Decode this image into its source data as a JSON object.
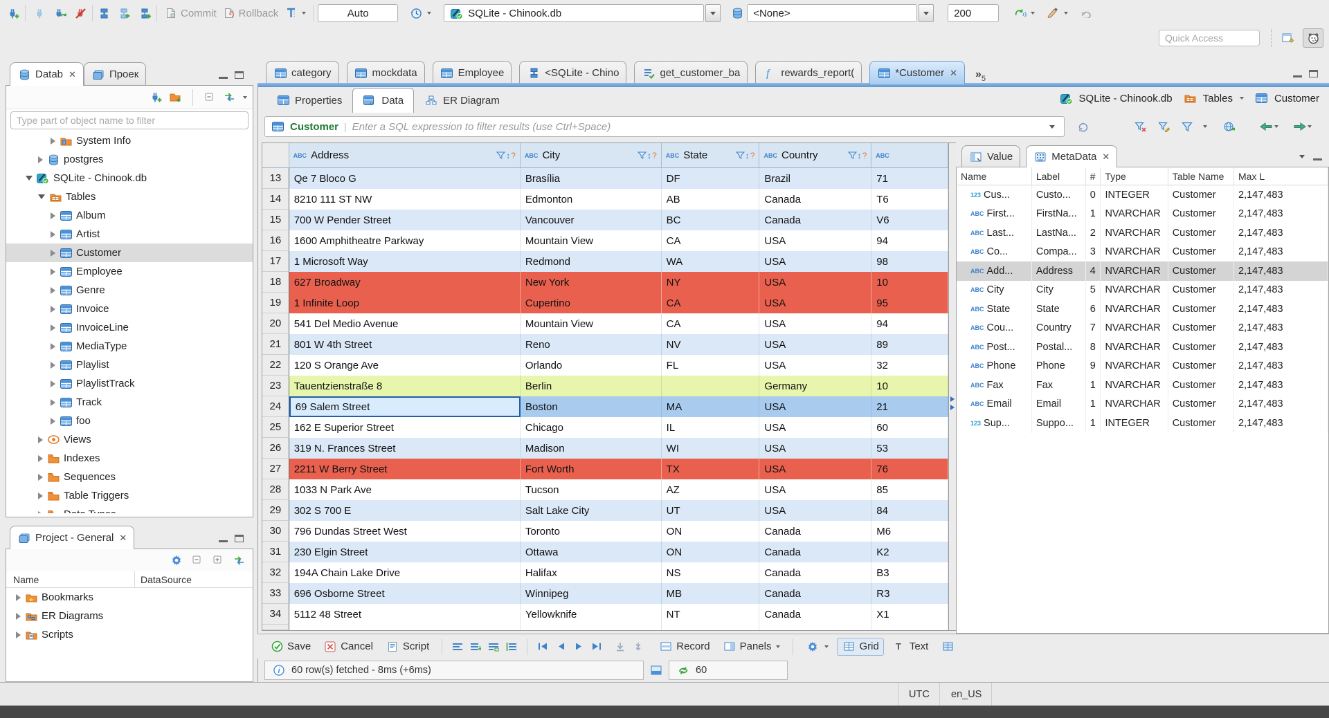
{
  "toolbar": {
    "commit": "Commit",
    "rollback": "Rollback",
    "auto": "Auto",
    "connection": "SQLite - Chinook.db",
    "schema": "<None>",
    "fetch_size": "200",
    "quick_access_placeholder": "Quick Access"
  },
  "navigator": {
    "tab_db": "Datab",
    "tab_project": "Проек",
    "filter_placeholder": "Type part of object name to filter",
    "tree": [
      {
        "label": "System Info",
        "icon": "folder_info",
        "depth": 3,
        "arrow": "right",
        "selected": false
      },
      {
        "label": "postgres",
        "icon": "db",
        "depth": 2,
        "arrow": "right",
        "selected": false
      },
      {
        "label": "SQLite - Chinook.db",
        "icon": "sqlite",
        "depth": 1,
        "arrow": "down",
        "selected": false
      },
      {
        "label": "Tables",
        "icon": "folder_table",
        "depth": 2,
        "arrow": "down",
        "selected": false
      },
      {
        "label": "Album",
        "icon": "table",
        "depth": 3,
        "arrow": "right",
        "selected": false
      },
      {
        "label": "Artist",
        "icon": "table",
        "depth": 3,
        "arrow": "right",
        "selected": false
      },
      {
        "label": "Customer",
        "icon": "table",
        "depth": 3,
        "arrow": "right",
        "selected": true
      },
      {
        "label": "Employee",
        "icon": "table",
        "depth": 3,
        "arrow": "right",
        "selected": false
      },
      {
        "label": "Genre",
        "icon": "table",
        "depth": 3,
        "arrow": "right",
        "selected": false
      },
      {
        "label": "Invoice",
        "icon": "table",
        "depth": 3,
        "arrow": "right",
        "selected": false
      },
      {
        "label": "InvoiceLine",
        "icon": "table",
        "depth": 3,
        "arrow": "right",
        "selected": false
      },
      {
        "label": "MediaType",
        "icon": "table",
        "depth": 3,
        "arrow": "right",
        "selected": false
      },
      {
        "label": "Playlist",
        "icon": "table",
        "depth": 3,
        "arrow": "right",
        "selected": false
      },
      {
        "label": "PlaylistTrack",
        "icon": "table",
        "depth": 3,
        "arrow": "right",
        "selected": false
      },
      {
        "label": "Track",
        "icon": "table",
        "depth": 3,
        "arrow": "right",
        "selected": false
      },
      {
        "label": "foo",
        "icon": "table",
        "depth": 3,
        "arrow": "right",
        "selected": false
      },
      {
        "label": "Views",
        "icon": "eye",
        "depth": 2,
        "arrow": "right",
        "selected": false
      },
      {
        "label": "Indexes",
        "icon": "folder",
        "depth": 2,
        "arrow": "right",
        "selected": false
      },
      {
        "label": "Sequences",
        "icon": "folder",
        "depth": 2,
        "arrow": "right",
        "selected": false
      },
      {
        "label": "Table Triggers",
        "icon": "folder",
        "depth": 2,
        "arrow": "right",
        "selected": false
      },
      {
        "label": "Data Types",
        "icon": "folder",
        "depth": 2,
        "arrow": "right",
        "selected": false
      }
    ]
  },
  "project": {
    "tab": "Project - General",
    "col_name": "Name",
    "col_datasource": "DataSource",
    "items": [
      {
        "label": "Bookmarks",
        "icon": "folder_star"
      },
      {
        "label": "ER Diagrams",
        "icon": "folder_diagram"
      },
      {
        "label": "Scripts",
        "icon": "folder_script"
      }
    ]
  },
  "editor": {
    "tabs": [
      {
        "label": "category",
        "icon": "table",
        "active": false,
        "closable": false
      },
      {
        "label": "mockdata",
        "icon": "table",
        "active": false,
        "closable": false
      },
      {
        "label": "Employee",
        "icon": "table",
        "active": false,
        "closable": false
      },
      {
        "label": "<SQLite - Chino",
        "icon": "sql",
        "active": false,
        "closable": false
      },
      {
        "label": "get_customer_ba",
        "icon": "sql_check",
        "active": false,
        "closable": false
      },
      {
        "label": "rewards_report(",
        "icon": "fx",
        "active": false,
        "closable": false
      },
      {
        "label": "*Customer",
        "icon": "table",
        "active": true,
        "closable": true
      }
    ],
    "overflow_chevron": "»",
    "overflow_count": "5",
    "subtabs": [
      {
        "label": "Properties",
        "icon": "table_props",
        "active": false
      },
      {
        "label": "Data",
        "icon": "table_data",
        "active": true
      },
      {
        "label": "ER Diagram",
        "icon": "er",
        "active": false
      }
    ],
    "breadcrumb": {
      "connection": "SQLite - Chinook.db",
      "folder": "Tables",
      "table": "Customer"
    }
  },
  "filter": {
    "table": "Customer",
    "placeholder": "Enter a SQL expression to filter results (use Ctrl+Space)"
  },
  "grid": {
    "columns": [
      {
        "label": "Address"
      },
      {
        "label": "City"
      },
      {
        "label": "State"
      },
      {
        "label": "Country"
      },
      {
        "label": ""
      }
    ],
    "rows": [
      {
        "n": "13",
        "address": "Qe 7 Bloco G",
        "city": "Brasília",
        "state": "DF",
        "country": "Brazil",
        "postal": "71",
        "style": "blue"
      },
      {
        "n": "14",
        "address": "8210 111 ST NW",
        "city": "Edmonton",
        "state": "AB",
        "country": "Canada",
        "postal": "T6",
        "style": "white"
      },
      {
        "n": "15",
        "address": "700 W Pender Street",
        "city": "Vancouver",
        "state": "BC",
        "country": "Canada",
        "postal": "V6",
        "style": "blue"
      },
      {
        "n": "16",
        "address": "1600 Amphitheatre Parkway",
        "city": "Mountain View",
        "state": "CA",
        "country": "USA",
        "postal": "94",
        "style": "white"
      },
      {
        "n": "17",
        "address": "1 Microsoft Way",
        "city": "Redmond",
        "state": "WA",
        "country": "USA",
        "postal": "98",
        "style": "blue"
      },
      {
        "n": "18",
        "address": "627 Broadway",
        "city": "New York",
        "state": "NY",
        "country": "USA",
        "postal": "10",
        "style": "red"
      },
      {
        "n": "19",
        "address": "1 Infinite Loop",
        "city": "Cupertino",
        "state": "CA",
        "country": "USA",
        "postal": "95",
        "style": "red"
      },
      {
        "n": "20",
        "address": "541 Del Medio Avenue",
        "city": "Mountain View",
        "state": "CA",
        "country": "USA",
        "postal": "94",
        "style": "white"
      },
      {
        "n": "21",
        "address": "801 W 4th Street",
        "city": "Reno",
        "state": "NV",
        "country": "USA",
        "postal": "89",
        "style": "blue"
      },
      {
        "n": "22",
        "address": "120 S Orange Ave",
        "city": "Orlando",
        "state": "FL",
        "country": "USA",
        "postal": "32",
        "style": "white"
      },
      {
        "n": "23",
        "address": "Tauentzienstraße 8",
        "city": "Berlin",
        "state": "",
        "country": "Germany",
        "postal": "10",
        "style": "green"
      },
      {
        "n": "24",
        "address": "69 Salem Street",
        "city": "Boston",
        "state": "MA",
        "country": "USA",
        "postal": "21",
        "style": "sel"
      },
      {
        "n": "25",
        "address": "162 E Superior Street",
        "city": "Chicago",
        "state": "IL",
        "country": "USA",
        "postal": "60",
        "style": "white"
      },
      {
        "n": "26",
        "address": "319 N. Frances Street",
        "city": "Madison",
        "state": "WI",
        "country": "USA",
        "postal": "53",
        "style": "blue"
      },
      {
        "n": "27",
        "address": "2211 W Berry Street",
        "city": "Fort Worth",
        "state": "TX",
        "country": "USA",
        "postal": "76",
        "style": "red"
      },
      {
        "n": "28",
        "address": "1033 N Park Ave",
        "city": "Tucson",
        "state": "AZ",
        "country": "USA",
        "postal": "85",
        "style": "white"
      },
      {
        "n": "29",
        "address": "302 S 700 E",
        "city": "Salt Lake City",
        "state": "UT",
        "country": "USA",
        "postal": "84",
        "style": "blue"
      },
      {
        "n": "30",
        "address": "796 Dundas Street West",
        "city": "Toronto",
        "state": "ON",
        "country": "Canada",
        "postal": "M6",
        "style": "white"
      },
      {
        "n": "31",
        "address": "230 Elgin Street",
        "city": "Ottawa",
        "state": "ON",
        "country": "Canada",
        "postal": "K2",
        "style": "blue"
      },
      {
        "n": "32",
        "address": "194A Chain Lake Drive",
        "city": "Halifax",
        "state": "NS",
        "country": "Canada",
        "postal": "B3",
        "style": "white"
      },
      {
        "n": "33",
        "address": "696 Osborne Street",
        "city": "Winnipeg",
        "state": "MB",
        "country": "Canada",
        "postal": "R3",
        "style": "blue"
      },
      {
        "n": "34",
        "address": "5112 48 Street",
        "city": "Yellowknife",
        "state": "NT",
        "country": "Canada",
        "postal": "X1",
        "style": "white"
      }
    ]
  },
  "meta": {
    "tab_value": "Value",
    "tab_metadata": "MetaData",
    "cols": [
      "Name",
      "Label",
      "#",
      "Type",
      "Table Name",
      "Max L"
    ],
    "rows": [
      {
        "icon": "123",
        "name": "Cus...",
        "label": "Custo...",
        "num": "0",
        "type": "INTEGER",
        "table": "Customer",
        "max": "2,147,483",
        "selected": false
      },
      {
        "icon": "abc",
        "name": "First...",
        "label": "FirstNa...",
        "num": "1",
        "type": "NVARCHAR",
        "table": "Customer",
        "max": "2,147,483",
        "selected": false
      },
      {
        "icon": "abc",
        "name": "Last...",
        "label": "LastNa...",
        "num": "2",
        "type": "NVARCHAR",
        "table": "Customer",
        "max": "2,147,483",
        "selected": false
      },
      {
        "icon": "abc",
        "name": "Co...",
        "label": "Compa...",
        "num": "3",
        "type": "NVARCHAR",
        "table": "Customer",
        "max": "2,147,483",
        "selected": false
      },
      {
        "icon": "abc",
        "name": "Add...",
        "label": "Address",
        "num": "4",
        "type": "NVARCHAR",
        "table": "Customer",
        "max": "2,147,483",
        "selected": true
      },
      {
        "icon": "abc",
        "name": "City",
        "label": "City",
        "num": "5",
        "type": "NVARCHAR",
        "table": "Customer",
        "max": "2,147,483",
        "selected": false
      },
      {
        "icon": "abc",
        "name": "State",
        "label": "State",
        "num": "6",
        "type": "NVARCHAR",
        "table": "Customer",
        "max": "2,147,483",
        "selected": false
      },
      {
        "icon": "abc",
        "name": "Cou...",
        "label": "Country",
        "num": "7",
        "type": "NVARCHAR",
        "table": "Customer",
        "max": "2,147,483",
        "selected": false
      },
      {
        "icon": "abc",
        "name": "Post...",
        "label": "Postal...",
        "num": "8",
        "type": "NVARCHAR",
        "table": "Customer",
        "max": "2,147,483",
        "selected": false
      },
      {
        "icon": "abc",
        "name": "Phone",
        "label": "Phone",
        "num": "9",
        "type": "NVARCHAR",
        "table": "Customer",
        "max": "2,147,483",
        "selected": false
      },
      {
        "icon": "abc",
        "name": "Fax",
        "label": "Fax",
        "num": "1",
        "type": "NVARCHAR",
        "table": "Customer",
        "max": "2,147,483",
        "selected": false
      },
      {
        "icon": "abc",
        "name": "Email",
        "label": "Email",
        "num": "1",
        "type": "NVARCHAR",
        "table": "Customer",
        "max": "2,147,483",
        "selected": false
      },
      {
        "icon": "123",
        "name": "Sup...",
        "label": "Suppo...",
        "num": "1",
        "type": "INTEGER",
        "table": "Customer",
        "max": "2,147,483",
        "selected": false
      }
    ]
  },
  "result_toolbar": {
    "save": "Save",
    "cancel": "Cancel",
    "script": "Script",
    "record": "Record",
    "panels": "Panels",
    "grid": "Grid",
    "text": "Text"
  },
  "status": {
    "fetch_info": "60 row(s) fetched - 8ms (+6ms)",
    "refresh_count": "60"
  },
  "statusbar": {
    "timezone": "UTC",
    "locale": "en_US"
  }
}
